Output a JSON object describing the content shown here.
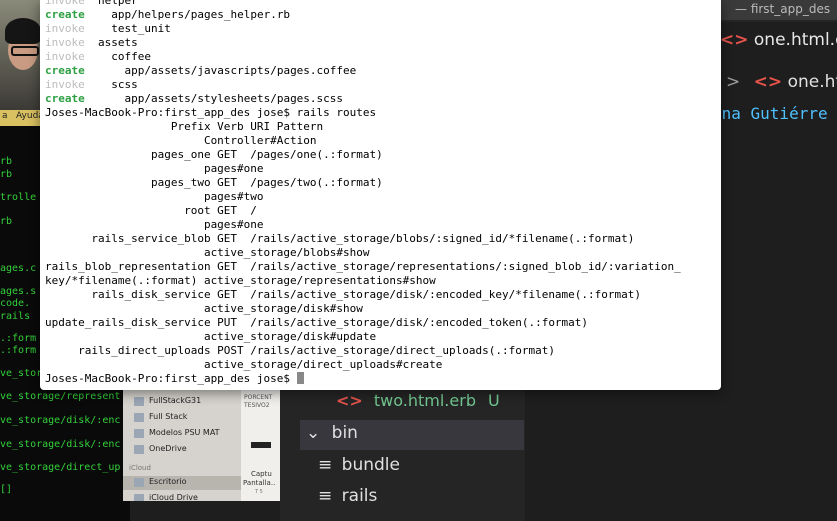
{
  "left_terminal": {
    "menubar_fragment": [
      "a",
      "Ayuda"
    ],
    "lines": [
      "rb",
      "rb",
      "trolle",
      "rb",
      "ages.c",
      "ages.s",
      "code.",
      "rails",
      ".:form",
      ".:form",
      "ve_stor",
      "ve_storage/represent",
      "ve_storage/disk/:enc",
      "ve_storage/disk/:enc",
      "ve_storage/direct_up",
      "[]"
    ]
  },
  "main_terminal": {
    "generator_lines": [
      {
        "action": "invoke",
        "text": "helper",
        "indent": 1
      },
      {
        "action": "create",
        "text": "app/helpers/pages_helper.rb",
        "indent": 2
      },
      {
        "action": "invoke",
        "text": "test_unit",
        "indent": 2
      },
      {
        "action": "invoke",
        "text": "assets",
        "indent": 1
      },
      {
        "action": "invoke",
        "text": "coffee",
        "indent": 2
      },
      {
        "action": "create",
        "text": "app/assets/javascripts/pages.coffee",
        "indent": 3
      },
      {
        "action": "invoke",
        "text": "scss",
        "indent": 2
      },
      {
        "action": "create",
        "text": "app/assets/stylesheets/pages.scss",
        "indent": 3
      }
    ],
    "prompt_command": "Joses-MacBook-Pro:first_app_des jose$ rails routes",
    "route_lines": [
      "                   Prefix Verb URI Pattern",
      "                        Controller#Action",
      "                pages_one GET  /pages/one(.:format)",
      "                        pages#one",
      "                pages_two GET  /pages/two(.:format)",
      "                        pages#two",
      "                     root GET  /",
      "                        pages#one",
      "       rails_service_blob GET  /rails/active_storage/blobs/:signed_id/*filename(.:format)",
      "                        active_storage/blobs#show",
      "rails_blob_representation GET  /rails/active_storage/representations/:signed_blob_id/:variation_",
      "key/*filename(.:format) active_storage/representations#show",
      "       rails_disk_service GET  /rails/active_storage/disk/:encoded_key/*filename(.:format)",
      "                        active_storage/disk#show",
      "update_rails_disk_service PUT  /rails/active_storage/disk/:encoded_token(.:format)",
      "                        active_storage/disk#update",
      "     rails_direct_uploads POST /rails/active_storage/direct_uploads(.:format)",
      "                        active_storage/direct_uploads#create"
    ],
    "final_prompt": "Joses-MacBook-Pro:first_app_des jose$ "
  },
  "vscode": {
    "window_title": "— first_app_des",
    "tab_label": "one.html.erb",
    "breadcrumb_label": "one.htm",
    "author_text": "ina Gutiérre",
    "explorer": {
      "file_label": "two.html.erb",
      "file_status": "U",
      "folder_label": "bin",
      "children": [
        "bundle",
        "rails"
      ]
    },
    "colors": {
      "editor_bg": "#1e1e1e",
      "accent_text": "#4fc1ff",
      "untracked": "#73c991"
    }
  },
  "finder": {
    "sidebar_items": [
      "FullStackG31",
      "Full Stack",
      "Modelos PSU MAT",
      "OneDrive"
    ],
    "section_header": "iCloud",
    "selected_item": "Escritorio",
    "partial_item": "iCloud Drive",
    "preview_labels": [
      "PORCENT",
      "TESIVO2",
      "Captu",
      "Pantalla..",
      "T 5"
    ]
  }
}
